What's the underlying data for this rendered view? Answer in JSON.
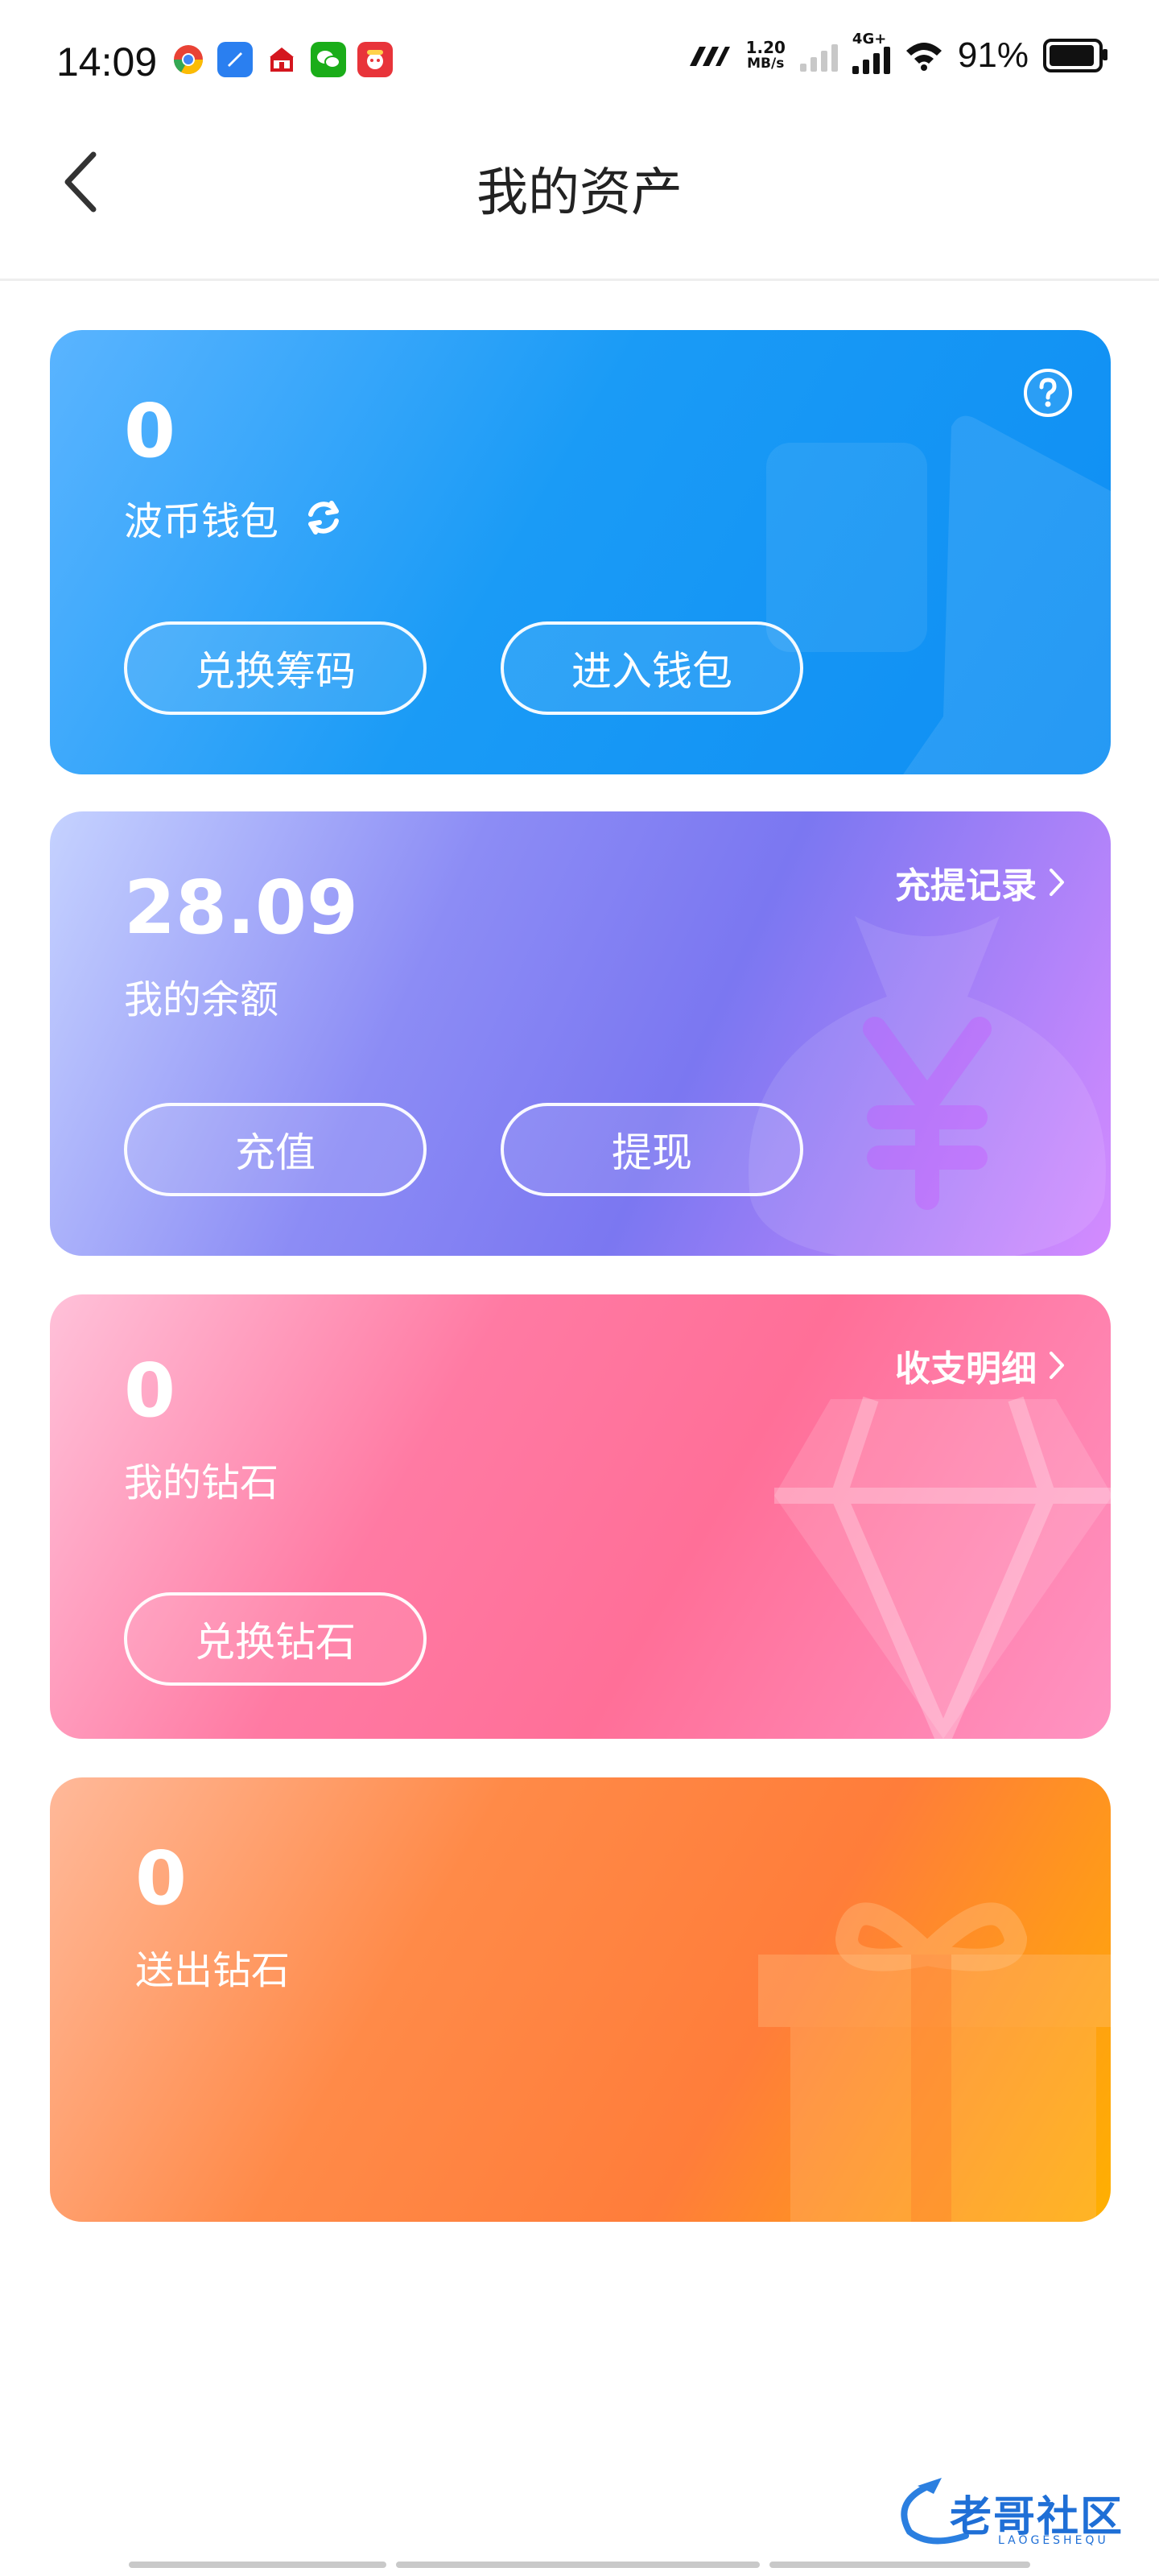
{
  "status_bar": {
    "time": "14:09",
    "speed_value": "1.20",
    "speed_unit": "MB/s",
    "network": "4G+",
    "battery": "91%",
    "app_icons": [
      "chrome-icon",
      "browser-icon",
      "bank-icon",
      "wechat-icon",
      "game-icon"
    ]
  },
  "header": {
    "title": "我的资产"
  },
  "wallet_card": {
    "amount": "0",
    "label": "波币钱包",
    "btn_exchange": "兑换筹码",
    "btn_enter": "进入钱包"
  },
  "balance_card": {
    "amount": "28.09",
    "label": "我的余额",
    "link": "充提记录",
    "btn_recharge": "充值",
    "btn_withdraw": "提现"
  },
  "diamond_card": {
    "amount": "0",
    "label": "我的钻石",
    "link": "收支明细",
    "btn_exchange": "兑换钻石"
  },
  "sent_card": {
    "amount": "0",
    "label": "送出钻石"
  },
  "watermark": {
    "text": "老哥社区",
    "sub": "LAOGESHEQU"
  }
}
